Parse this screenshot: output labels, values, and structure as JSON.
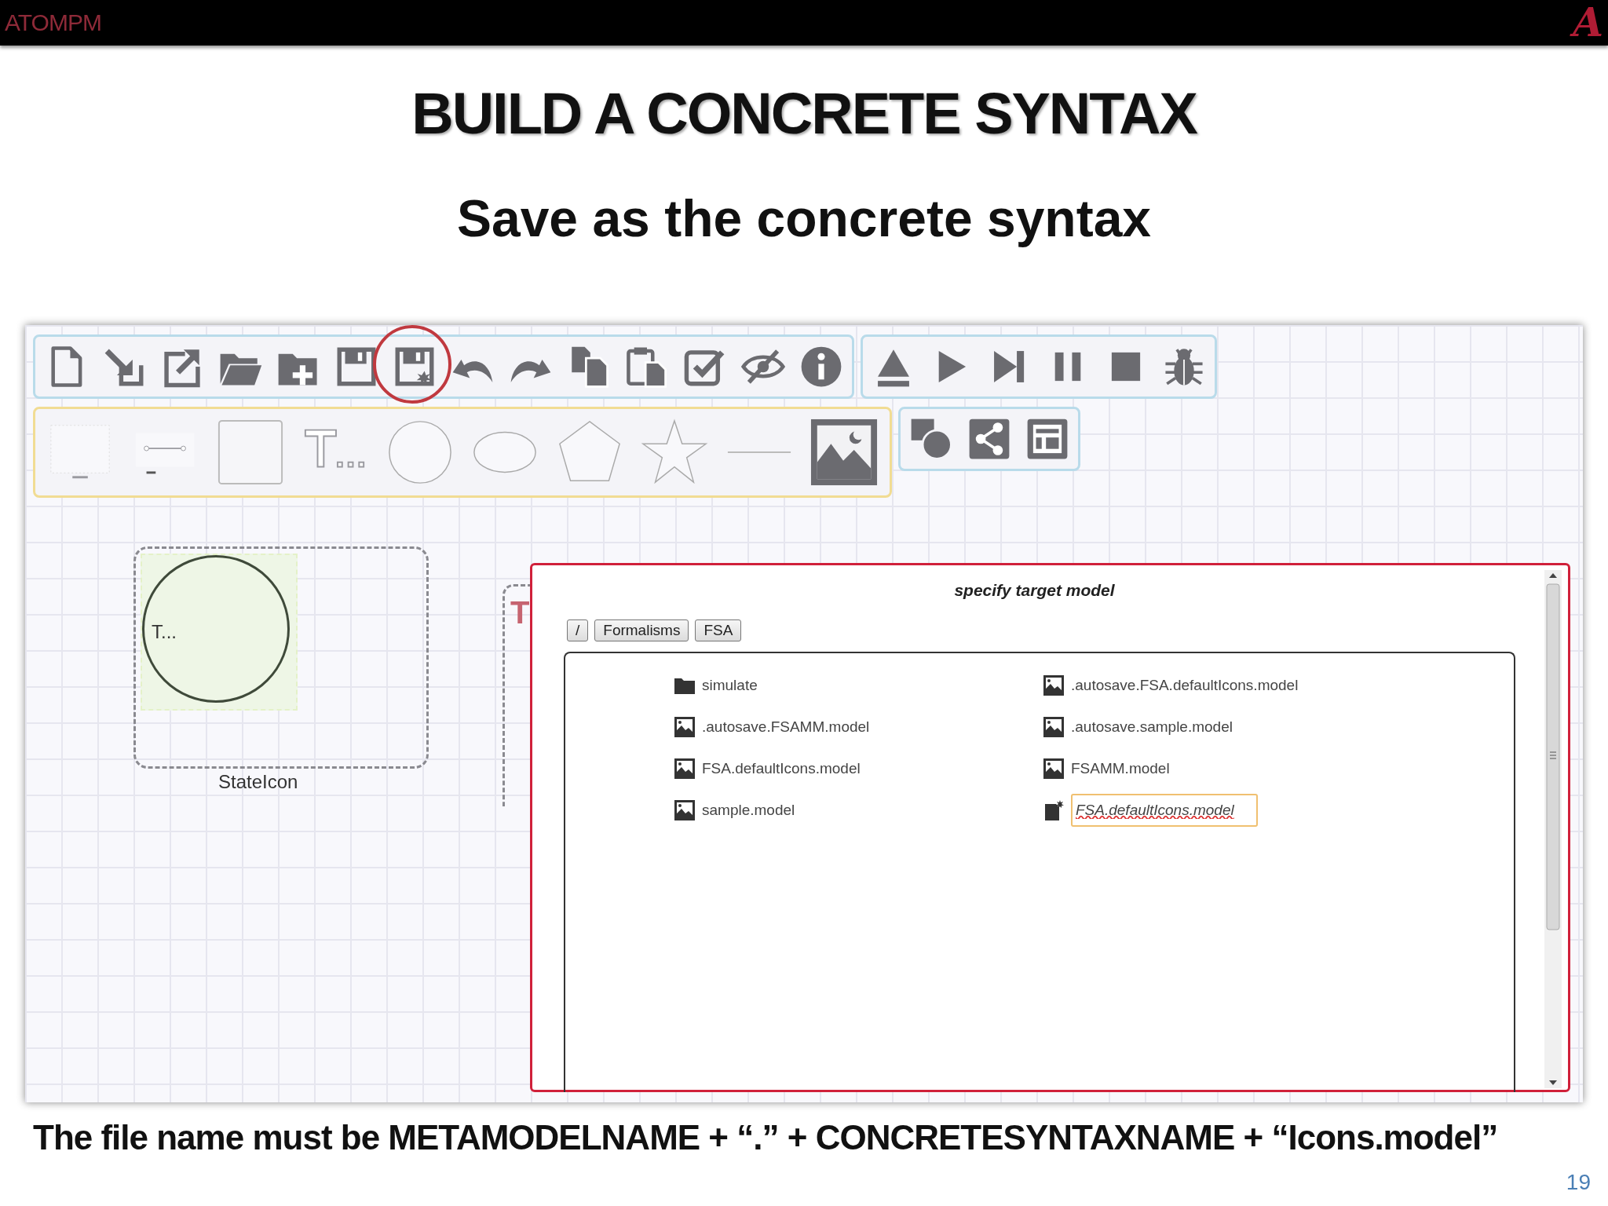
{
  "header": {
    "logo": "ATOMPM",
    "emblem": "A"
  },
  "title": "BUILD A CONCRETE SYNTAX",
  "subtitle": "Save as the concrete syntax",
  "main_toolbar": [
    {
      "circled": false
    },
    {
      "circled": false
    },
    {
      "circled": false
    },
    {
      "circled": false
    },
    {
      "circled": false
    },
    {
      "circled": false
    },
    {
      "circled": true
    },
    {
      "circled": false
    },
    {
      "circled": false
    },
    {
      "circled": false
    },
    {
      "circled": false
    },
    {
      "circled": false
    },
    {
      "circled": false
    },
    {
      "circled": false
    }
  ],
  "canvas": {
    "node_inner_label": "T...",
    "node_label": "StateIcon",
    "partial_label": "T"
  },
  "dialog": {
    "title": "specify target model",
    "breadcrumbs": [
      "/",
      "Formalisms",
      "FSA"
    ],
    "files": [
      {
        "kind": "folder",
        "name": "simulate"
      },
      {
        "kind": "model",
        "name": ".autosave.FSA.defaultIcons.model"
      },
      {
        "kind": "model",
        "name": ".autosave.FSAMM.model"
      },
      {
        "kind": "model",
        "name": ".autosave.sample.model"
      },
      {
        "kind": "model",
        "name": "FSA.defaultIcons.model"
      },
      {
        "kind": "model",
        "name": "FSAMM.model"
      },
      {
        "kind": "model",
        "name": "sample.model"
      },
      {
        "kind": "new",
        "value": "FSA.defaultIcons.model"
      }
    ]
  },
  "caption": "The file name must be METAMODELNAME + “.” + CONCRETESYNTAXNAME + “Icons.model”",
  "page_number": "19"
}
